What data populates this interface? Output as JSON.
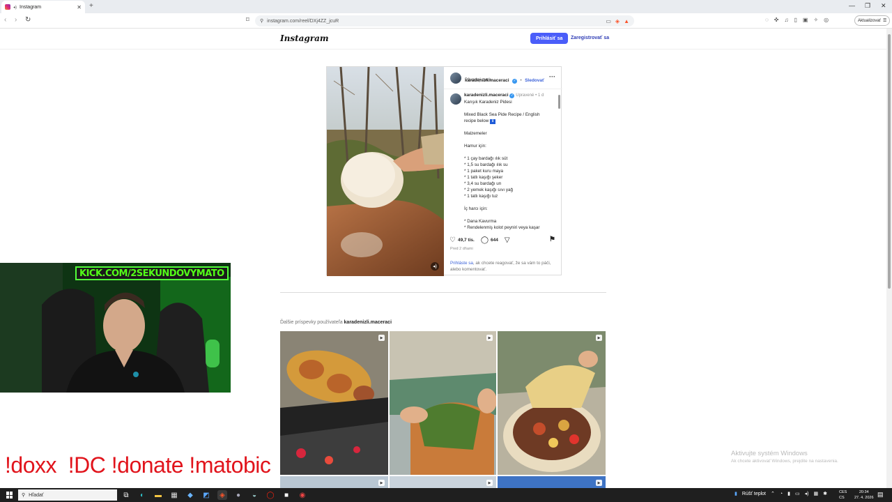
{
  "browser": {
    "tab_title": "Instagram",
    "url": "instagram.com/reel/DXj4ZZ_jcuR",
    "update_label": "Aktualizovať",
    "new_tab_symbol": "+",
    "close_symbol": "✕"
  },
  "instagram": {
    "logo": "Instagram",
    "login_label": "Prihlásiť sa",
    "signup_label": "Zaregistrovať sa",
    "post": {
      "username": "karadenizli.maceraci",
      "follow_label": "Sledovať",
      "audio_label": "Pôvodný zvuk",
      "caption_username": "karadenizli.maceraci",
      "caption_edited": "Upravené",
      "caption_age": "1 d",
      "caption_lines": [
        "Karışık Karadeniz Pidesi ",
        "",
        "Mixed Black Sea Pide Recipe / English",
        "recipe below ",
        "",
        "Malzemeler",
        "",
        "Hamur için:",
        "",
        "* 1 çay bardağı ılık süt",
        "* 1,5 su bardağı ılık su",
        "* 1 paket kuru maya",
        "* 1 tatlı kaşığı şeker",
        "* 3,4 su bardağı un",
        "* 2 yemek kaşığı sıvı yağ",
        "* 1 tatlı kaşığı tuz",
        "",
        "İç harcı için:",
        "",
        "* Dana Kavurma",
        "* Rendelenmiş kolot peyniri veya kaşar"
      ],
      "likes": "49,7 tis.",
      "comments": "644",
      "time": "Pred 2 dňami",
      "login_prompt_link": "Prihláste sa",
      "login_prompt_text": ", ak chcete reagovať, že sa vám to páči, alebo komentovať."
    },
    "more_posts_prefix": "Ďalšie príspevky používateľa ",
    "more_posts_user": "karadenizli.maceraci"
  },
  "overlay": {
    "cam_banner": "KICK.COM/2SEKUNDOVYMATO",
    "commands": "!doxx  !DC !donate !matobic"
  },
  "windows": {
    "activate_title": "Aktivujte systém Windows",
    "activate_sub": "Ak chcete aktivovať Windows, prejdite na nastavenia.",
    "search_placeholder": "Hľadať",
    "weather": "Rúšť teplot",
    "lang_1": "CES",
    "lang_2": "CS",
    "time": "20:34",
    "date": "27. 4. 2026"
  },
  "icons": [
    "back-icon",
    "forward-icon",
    "reload-icon",
    "bookmark-icon",
    "site-info-icon",
    "brave-shield-icon",
    "more-icon",
    "heart-icon",
    "comment-icon",
    "share-icon",
    "save-icon",
    "verified-icon",
    "mute-icon",
    "reel-icon",
    "search-icon",
    "windows-start-icon"
  ],
  "colors": {
    "instagram_primary": "#4a5df9",
    "link": "#3d63d9",
    "kick_green": "#53fc18",
    "command_red": "#e1141c"
  }
}
